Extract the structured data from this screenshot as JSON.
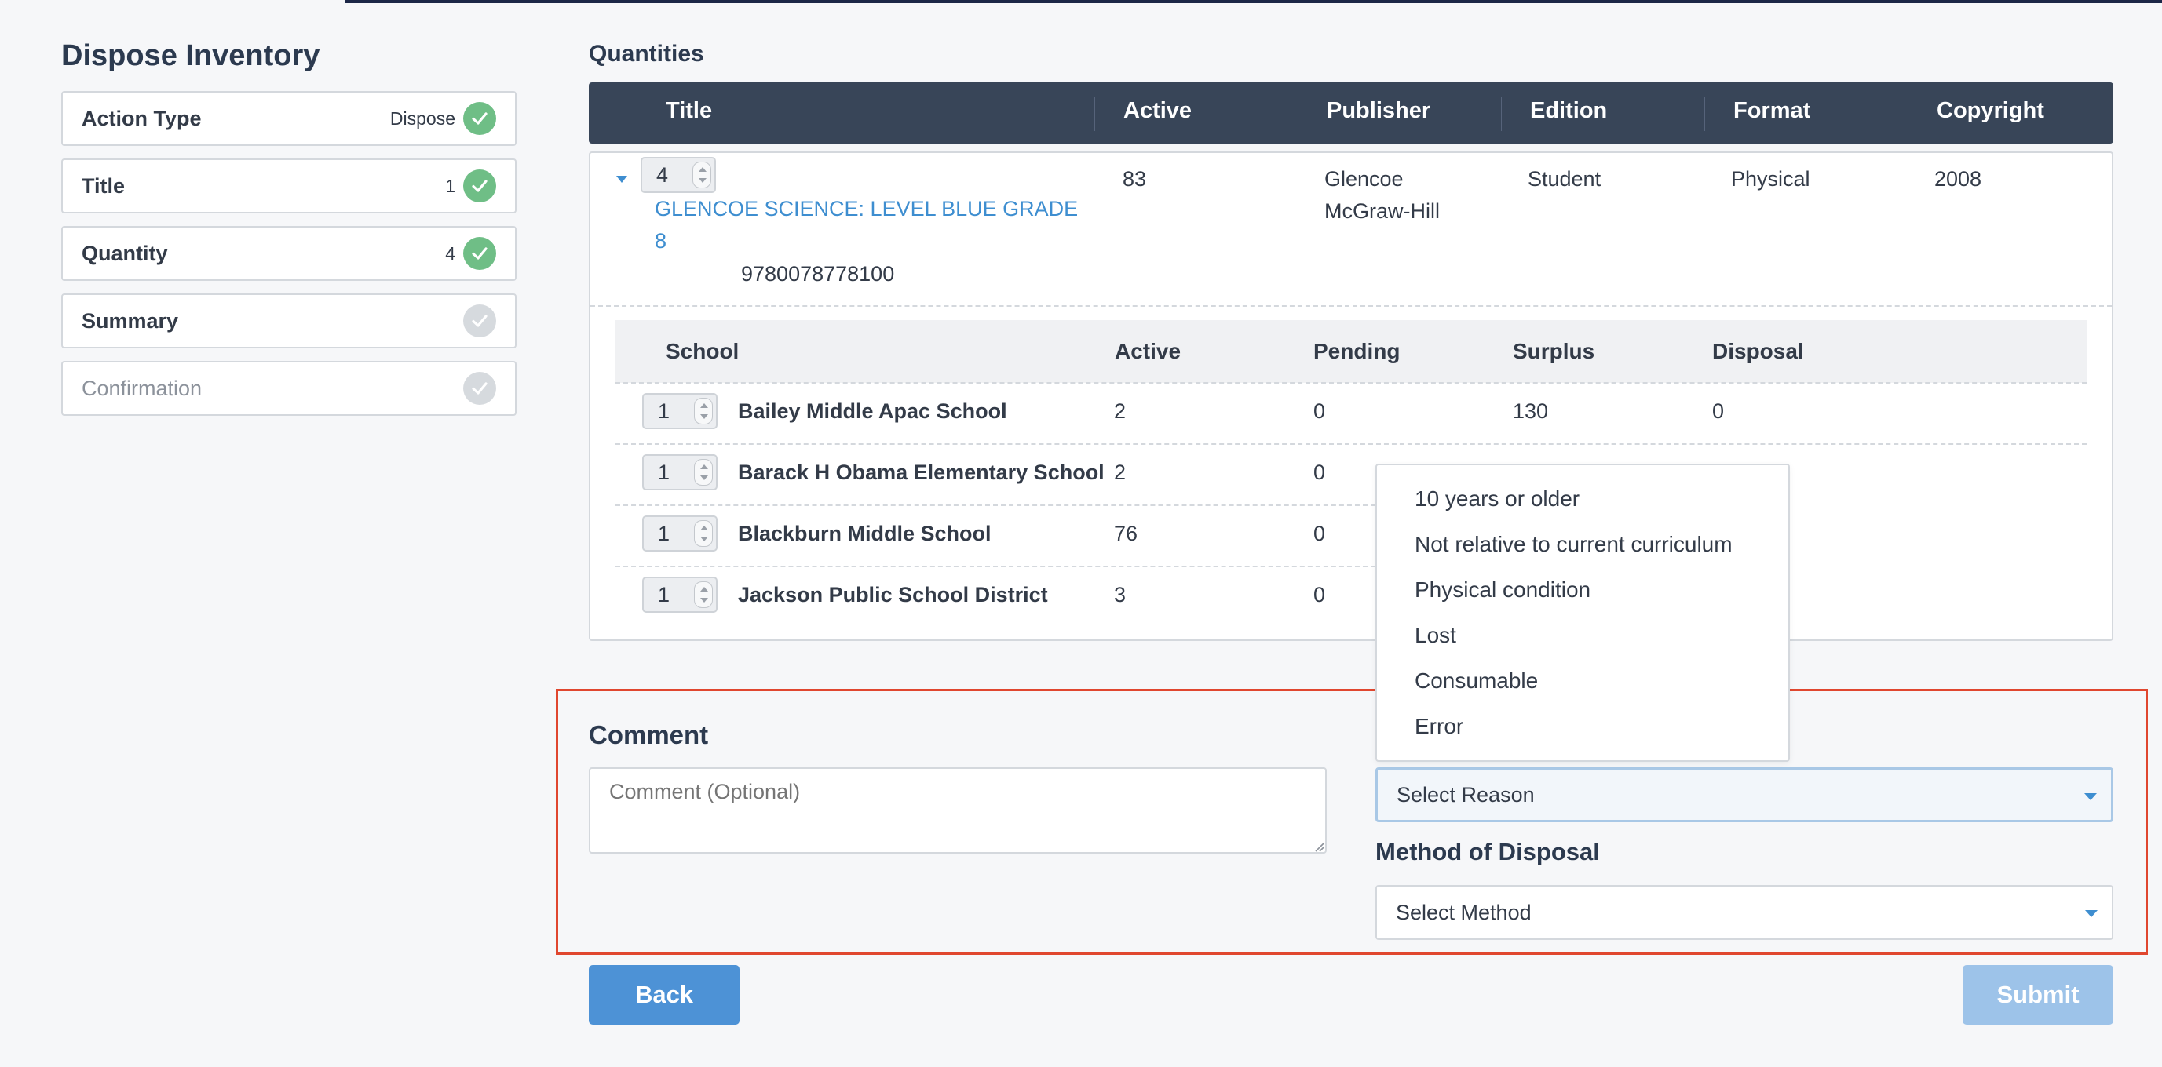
{
  "page": {
    "title": "Dispose Inventory"
  },
  "steps": [
    {
      "label": "Action Type",
      "value": "Dispose",
      "done": true
    },
    {
      "label": "Title",
      "value": "1",
      "done": true
    },
    {
      "label": "Quantity",
      "value": "4",
      "done": true
    },
    {
      "label": "Summary",
      "value": "",
      "done": false
    },
    {
      "label": "Confirmation",
      "value": "",
      "done": false
    }
  ],
  "quantities": {
    "heading": "Quantities",
    "columns": [
      "Title",
      "Active",
      "Publisher",
      "Edition",
      "Format",
      "Copyright"
    ],
    "title_row": {
      "quantity": "4",
      "title_line1": "GLENCOE SCIENCE: LEVEL BLUE GRADE",
      "title_line2": "8",
      "isbn": "9780078778100",
      "active": "83",
      "publisher_line1": "Glencoe",
      "publisher_line2": "McGraw-Hill",
      "edition": "Student",
      "format": "Physical",
      "copyright": "2008"
    },
    "school_columns": [
      "School",
      "Active",
      "Pending",
      "Surplus",
      "Disposal"
    ],
    "schools": [
      {
        "qty": "1",
        "name": "Bailey Middle Apac School",
        "active": "2",
        "pending": "0",
        "surplus": "130",
        "disposal": "0"
      },
      {
        "qty": "1",
        "name": "Barack H Obama Elementary School",
        "active": "2",
        "pending": "0"
      },
      {
        "qty": "1",
        "name": "Blackburn Middle School",
        "active": "76",
        "pending": "0"
      },
      {
        "qty": "1",
        "name": "Jackson Public School District",
        "active": "3",
        "pending": "0"
      }
    ]
  },
  "reason_menu": {
    "options": [
      "10 years or older",
      "Not relative to current curriculum",
      "Physical condition",
      "Lost",
      "Consumable",
      "Error"
    ]
  },
  "comment": {
    "label": "Comment",
    "placeholder": "Comment (Optional)"
  },
  "reason": {
    "value": "Select Reason"
  },
  "method": {
    "label": "Method of Disposal",
    "value": "Select Method"
  },
  "buttons": {
    "back": "Back",
    "submit": "Submit"
  },
  "colors": {
    "accent": "#4d92d6",
    "header": "#384558",
    "success": "#6fbe86",
    "highlight": "#e0472f",
    "link": "#3e8ed0"
  }
}
